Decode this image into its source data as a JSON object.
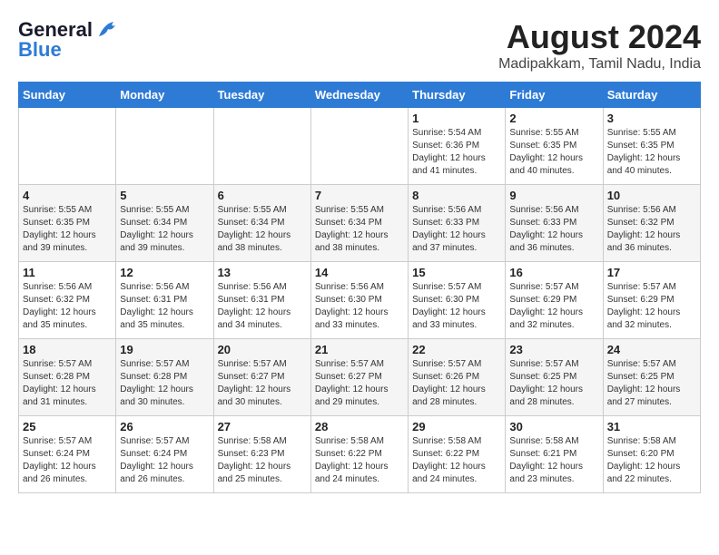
{
  "header": {
    "logo_general": "General",
    "logo_blue": "Blue",
    "month_year": "August 2024",
    "location": "Madipakkam, Tamil Nadu, India"
  },
  "days_of_week": [
    "Sunday",
    "Monday",
    "Tuesday",
    "Wednesday",
    "Thursday",
    "Friday",
    "Saturday"
  ],
  "weeks": [
    [
      {
        "day": "",
        "info": ""
      },
      {
        "day": "",
        "info": ""
      },
      {
        "day": "",
        "info": ""
      },
      {
        "day": "",
        "info": ""
      },
      {
        "day": "1",
        "info": "Sunrise: 5:54 AM\nSunset: 6:36 PM\nDaylight: 12 hours\nand 41 minutes."
      },
      {
        "day": "2",
        "info": "Sunrise: 5:55 AM\nSunset: 6:35 PM\nDaylight: 12 hours\nand 40 minutes."
      },
      {
        "day": "3",
        "info": "Sunrise: 5:55 AM\nSunset: 6:35 PM\nDaylight: 12 hours\nand 40 minutes."
      }
    ],
    [
      {
        "day": "4",
        "info": "Sunrise: 5:55 AM\nSunset: 6:35 PM\nDaylight: 12 hours\nand 39 minutes."
      },
      {
        "day": "5",
        "info": "Sunrise: 5:55 AM\nSunset: 6:34 PM\nDaylight: 12 hours\nand 39 minutes."
      },
      {
        "day": "6",
        "info": "Sunrise: 5:55 AM\nSunset: 6:34 PM\nDaylight: 12 hours\nand 38 minutes."
      },
      {
        "day": "7",
        "info": "Sunrise: 5:55 AM\nSunset: 6:34 PM\nDaylight: 12 hours\nand 38 minutes."
      },
      {
        "day": "8",
        "info": "Sunrise: 5:56 AM\nSunset: 6:33 PM\nDaylight: 12 hours\nand 37 minutes."
      },
      {
        "day": "9",
        "info": "Sunrise: 5:56 AM\nSunset: 6:33 PM\nDaylight: 12 hours\nand 36 minutes."
      },
      {
        "day": "10",
        "info": "Sunrise: 5:56 AM\nSunset: 6:32 PM\nDaylight: 12 hours\nand 36 minutes."
      }
    ],
    [
      {
        "day": "11",
        "info": "Sunrise: 5:56 AM\nSunset: 6:32 PM\nDaylight: 12 hours\nand 35 minutes."
      },
      {
        "day": "12",
        "info": "Sunrise: 5:56 AM\nSunset: 6:31 PM\nDaylight: 12 hours\nand 35 minutes."
      },
      {
        "day": "13",
        "info": "Sunrise: 5:56 AM\nSunset: 6:31 PM\nDaylight: 12 hours\nand 34 minutes."
      },
      {
        "day": "14",
        "info": "Sunrise: 5:56 AM\nSunset: 6:30 PM\nDaylight: 12 hours\nand 33 minutes."
      },
      {
        "day": "15",
        "info": "Sunrise: 5:57 AM\nSunset: 6:30 PM\nDaylight: 12 hours\nand 33 minutes."
      },
      {
        "day": "16",
        "info": "Sunrise: 5:57 AM\nSunset: 6:29 PM\nDaylight: 12 hours\nand 32 minutes."
      },
      {
        "day": "17",
        "info": "Sunrise: 5:57 AM\nSunset: 6:29 PM\nDaylight: 12 hours\nand 32 minutes."
      }
    ],
    [
      {
        "day": "18",
        "info": "Sunrise: 5:57 AM\nSunset: 6:28 PM\nDaylight: 12 hours\nand 31 minutes."
      },
      {
        "day": "19",
        "info": "Sunrise: 5:57 AM\nSunset: 6:28 PM\nDaylight: 12 hours\nand 30 minutes."
      },
      {
        "day": "20",
        "info": "Sunrise: 5:57 AM\nSunset: 6:27 PM\nDaylight: 12 hours\nand 30 minutes."
      },
      {
        "day": "21",
        "info": "Sunrise: 5:57 AM\nSunset: 6:27 PM\nDaylight: 12 hours\nand 29 minutes."
      },
      {
        "day": "22",
        "info": "Sunrise: 5:57 AM\nSunset: 6:26 PM\nDaylight: 12 hours\nand 28 minutes."
      },
      {
        "day": "23",
        "info": "Sunrise: 5:57 AM\nSunset: 6:25 PM\nDaylight: 12 hours\nand 28 minutes."
      },
      {
        "day": "24",
        "info": "Sunrise: 5:57 AM\nSunset: 6:25 PM\nDaylight: 12 hours\nand 27 minutes."
      }
    ],
    [
      {
        "day": "25",
        "info": "Sunrise: 5:57 AM\nSunset: 6:24 PM\nDaylight: 12 hours\nand 26 minutes."
      },
      {
        "day": "26",
        "info": "Sunrise: 5:57 AM\nSunset: 6:24 PM\nDaylight: 12 hours\nand 26 minutes."
      },
      {
        "day": "27",
        "info": "Sunrise: 5:58 AM\nSunset: 6:23 PM\nDaylight: 12 hours\nand 25 minutes."
      },
      {
        "day": "28",
        "info": "Sunrise: 5:58 AM\nSunset: 6:22 PM\nDaylight: 12 hours\nand 24 minutes."
      },
      {
        "day": "29",
        "info": "Sunrise: 5:58 AM\nSunset: 6:22 PM\nDaylight: 12 hours\nand 24 minutes."
      },
      {
        "day": "30",
        "info": "Sunrise: 5:58 AM\nSunset: 6:21 PM\nDaylight: 12 hours\nand 23 minutes."
      },
      {
        "day": "31",
        "info": "Sunrise: 5:58 AM\nSunset: 6:20 PM\nDaylight: 12 hours\nand 22 minutes."
      }
    ]
  ]
}
